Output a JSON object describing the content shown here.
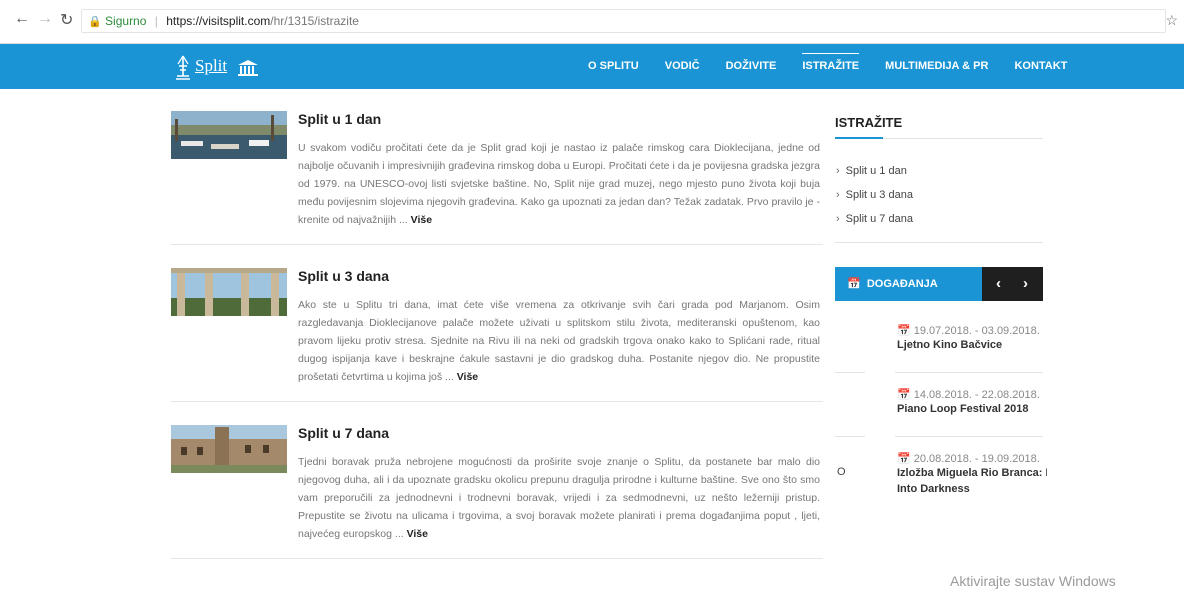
{
  "browser": {
    "secure_label": "Sigurno",
    "url_base": "https://visitsplit.com",
    "url_path": "/hr/1315/istrazite"
  },
  "header": {
    "logo_text": "Split",
    "menu": [
      "O SPLITU",
      "VODIČ",
      "DOŽIVITE",
      "ISTRAŽITE",
      "MULTIMEDIJA & PR",
      "KONTAKT"
    ],
    "active_menu": "ISTRAŽITE"
  },
  "articles": [
    {
      "title": "Split u 1 dan",
      "text": "U svakom vodiču pročitati ćete da je Split grad koji je nastao iz palače rimskog cara Dioklecijana, jedne od najbolje očuvanih i impresivnijih građevina rimskog doba u Europi. Pročitati ćete i da je povijesna gradska jezgra od 1979. na UNESCO-ovoj listi svjetske baštine. No, Split nije grad muzej, nego mjesto puno života koji buja među povijesnim slojevima njegovih građevina. Kako ga upoznati za jedan dan? Težak zadatak. Prvo pravilo je - krenite od najvažnijih ...",
      "more": "Više"
    },
    {
      "title": "Split u 3 dana",
      "text": "Ako ste u Splitu tri dana, imat ćete više vremena za otkrivanje svih čari grada pod Marjanom. Osim razgledavanja Dioklecijanove palače možete uživati u splitskom stilu života, mediteranski opuštenom, kao pravom lijeku protiv stresa. Sjednite na Rivu ili na neki od gradskih trgova onako kako to Splićani rade, ritual dugog ispijanja kave i beskrajne ćakule sastavni je dio gradskog duha. Postanite njegov dio. Ne propustite prošetati četvrtima u kojima još ...",
      "more": "Više"
    },
    {
      "title": "Split u 7 dana",
      "text": "Tjedni boravak pruža nebrojene mogućnosti da proširite svoje znanje o Splitu, da postanete bar malo dio njegovog duha, ali i da upoznate gradsku okolicu prepunu dragulja prirodne i kulturne baštine. Sve ono što smo vam preporučili za jednodnevni i trodnevni boravak, vrijedi i za sedmodnevni, uz nešto ležerniji pristup. Prepustite se životu na ulicama i trgovima, a svoj boravak možete planirati i prema događanjima poput , ljeti, najvećeg europskog  ...",
      "more": "Više"
    }
  ],
  "sidebar": {
    "title": "ISTRAŽITE",
    "links": [
      "Split u 1 dan",
      "Split u 3 dana",
      "Split u 7 dana"
    ],
    "events_title": "DOGAĐANJA",
    "events": [
      {
        "date": "19.07.2018. - 03.09.2018.",
        "name": "Ljetno Kino Bačvice"
      },
      {
        "date": "14.08.2018. - 22.08.2018.",
        "name": "Piano Loop Festival 2018"
      },
      {
        "date": "20.08.2018. - 19.09.2018.",
        "name": "Izložba Miguela Rio Branca: D",
        "name2": "Into Darkness"
      }
    ],
    "stray_char": "O"
  },
  "watermark": "Aktivirajte sustav Windows",
  "colors": {
    "brand_blue": "#1a94d4",
    "nav_dark": "#1f1f1f"
  }
}
